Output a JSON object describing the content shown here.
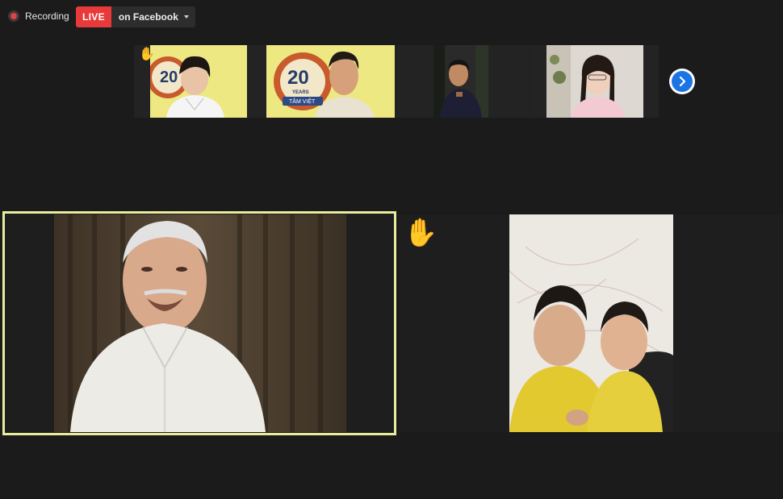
{
  "status": {
    "recording_label": "Recording",
    "live_badge": "LIVE",
    "live_destination": "on Facebook"
  },
  "thumbnails": [
    {
      "participant": "participant-1",
      "hand_raised": true
    },
    {
      "participant": "participant-2",
      "hand_raised": false
    },
    {
      "participant": "participant-3",
      "hand_raised": false
    },
    {
      "participant": "participant-4",
      "hand_raised": false
    }
  ],
  "logo": {
    "number": "20",
    "years": "YEARS",
    "brand": "TÂM VIỆT"
  },
  "main_tiles": [
    {
      "participant": "active-speaker",
      "active": true
    },
    {
      "participant": "participant-children",
      "hand_raised": true
    }
  ],
  "icons": {
    "raise_hand": "✋",
    "next": "chevron-right-icon"
  },
  "colors": {
    "live_red": "#e83a3a",
    "active_border": "#e8ec9b",
    "accent_blue": "#1b74e4"
  }
}
